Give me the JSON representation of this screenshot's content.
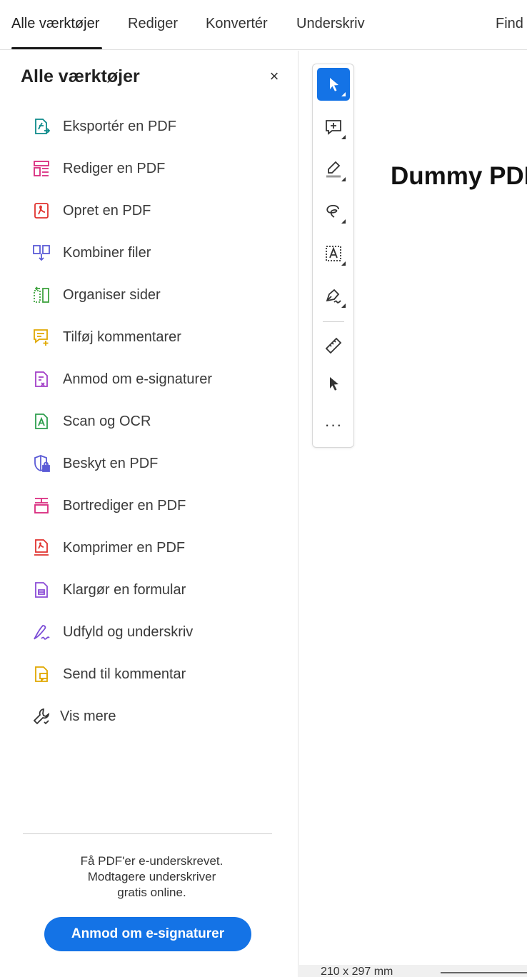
{
  "nav": {
    "tabs": [
      {
        "label": "Alle værktøjer"
      },
      {
        "label": "Rediger"
      },
      {
        "label": "Konvertér"
      },
      {
        "label": "Underskriv"
      }
    ],
    "find_label": "Find"
  },
  "panel": {
    "title": "Alle værktøjer",
    "close_glyph": "×",
    "tools": [
      {
        "label": "Eksportér en PDF",
        "icon": "export-pdf-icon",
        "color": "#0d8a8a"
      },
      {
        "label": "Rediger en PDF",
        "icon": "edit-pdf-icon",
        "color": "#d9297e"
      },
      {
        "label": "Opret en PDF",
        "icon": "create-pdf-icon",
        "color": "#e0322e"
      },
      {
        "label": "Kombiner filer",
        "icon": "combine-files-icon",
        "color": "#5b5bd6"
      },
      {
        "label": "Organiser sider",
        "icon": "organize-pages-icon",
        "color": "#3fa33f"
      },
      {
        "label": "Tilføj kommentarer",
        "icon": "add-comment-icon",
        "color": "#e0a800"
      },
      {
        "label": "Anmod om e-signaturer",
        "icon": "request-esign-icon",
        "color": "#a23fc8"
      },
      {
        "label": "Scan og OCR",
        "icon": "scan-ocr-icon",
        "color": "#2e9e4e"
      },
      {
        "label": "Beskyt en PDF",
        "icon": "protect-pdf-icon",
        "color": "#5b5bd6"
      },
      {
        "label": "Bortrediger en PDF",
        "icon": "redact-pdf-icon",
        "color": "#d9297e"
      },
      {
        "label": "Komprimer en PDF",
        "icon": "compress-pdf-icon",
        "color": "#e0322e"
      },
      {
        "label": "Klargør en formular",
        "icon": "prepare-form-icon",
        "color": "#8b4bd6"
      },
      {
        "label": "Udfyld og underskriv",
        "icon": "fill-sign-icon",
        "color": "#7a4bd6"
      },
      {
        "label": "Send til kommentar",
        "icon": "send-comment-icon",
        "color": "#e0a800"
      },
      {
        "label": "Vis mere",
        "icon": "wrench-icon",
        "color": "#333333"
      }
    ],
    "promo_lines": [
      "Få PDF'er e-underskrevet.",
      "Modtagere underskriver",
      "gratis online."
    ],
    "cta_label": "Anmod om e-signaturer"
  },
  "toolbar": {
    "buttons": [
      {
        "icon": "select-cursor-icon",
        "active": true
      },
      {
        "icon": "add-comment-icon",
        "active": false
      },
      {
        "icon": "highlight-pen-icon",
        "active": false
      },
      {
        "icon": "freehand-draw-icon",
        "active": false
      },
      {
        "icon": "text-box-icon",
        "active": false
      },
      {
        "icon": "fill-sign-pen-icon",
        "active": false
      },
      {
        "icon": "measure-ruler-icon",
        "active": false
      },
      {
        "icon": "pointer-icon",
        "active": false
      }
    ],
    "more_glyph": "···"
  },
  "document": {
    "title": "Dummy PDF"
  },
  "status": {
    "page_size": "210 x 297 mm"
  },
  "colors": {
    "accent": "#1473e6"
  }
}
